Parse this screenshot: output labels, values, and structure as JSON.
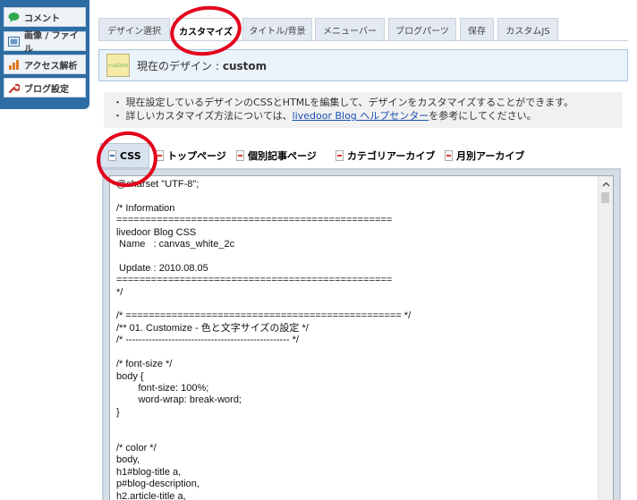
{
  "sidebar": {
    "items": [
      {
        "label": "コメント",
        "icon": "comment-icon"
      },
      {
        "label": "画像 / ファイル",
        "icon": "image-file-icon"
      },
      {
        "label": "アクセス解析",
        "icon": "analytics-icon"
      },
      {
        "label": "ブログ設定",
        "icon": "wrench-icon"
      }
    ]
  },
  "tabs": [
    {
      "label": "デザイン選択"
    },
    {
      "label": "カスタマイズ"
    },
    {
      "label": "タイトル/背景"
    },
    {
      "label": "メニューバー"
    },
    {
      "label": "ブログパーツ"
    },
    {
      "label": "保存"
    },
    {
      "label": "カスタムJS"
    }
  ],
  "design": {
    "label": "現在のデザイン :",
    "name": "custom",
    "thumb_text": "custom"
  },
  "info": {
    "line1": "・ 現在設定しているデザインのCSSとHTMLを編集して、デザインをカスタマイズすることができます。",
    "line2_prefix": "・ 詳しいカスタマイズ方法については、",
    "line2_link": "livedoor Blog ヘルプセンター",
    "line2_suffix": "を参考にしてください。"
  },
  "file_tabs": [
    {
      "label": "CSS"
    },
    {
      "label": "トップページ"
    },
    {
      "label": "個別記事ページ"
    },
    {
      "label": "カテゴリアーカイブ"
    },
    {
      "label": "月別アーカイブ"
    }
  ],
  "editor": {
    "content": "@charset \"UTF-8\";\n\n/* Information\n================================================\nlivedoor Blog CSS\n Name   : canvas_white_2c\n\n Update : 2010.08.05\n================================================\n*/\n\n/* ================================================ */\n/** 01. Customize - 色と文字サイズの設定 */\n/* -------------------------------------------------- */\n\n/* font-size */\nbody {\n        font-size: 100%;\n        word-wrap: break-word;\n}\n\n\n/* color */\nbody,\nh1#blog-title a,\np#blog-description,\nh2.article-title a,"
  },
  "colors": {
    "sidebar": "#2e6da4",
    "annotation": "#e3001b",
    "link": "#1a4fb5"
  }
}
